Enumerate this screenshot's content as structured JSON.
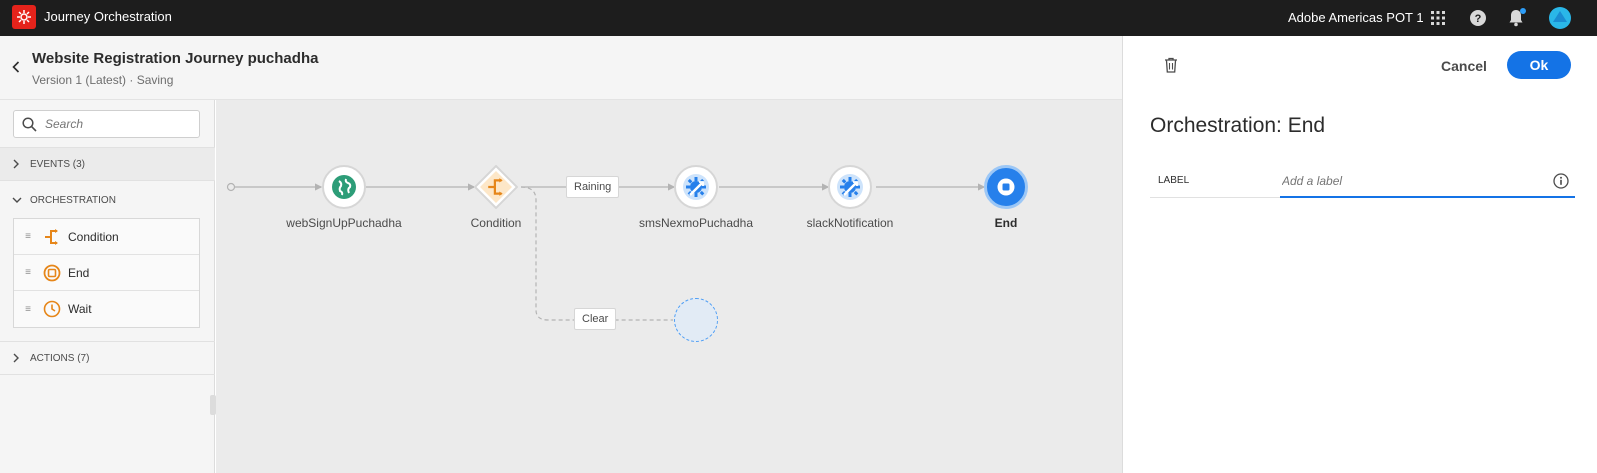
{
  "topbar": {
    "app_title": "Journey Orchestration",
    "org_name": "Adobe Americas POT 1",
    "icons": [
      "app-switcher-icon",
      "help-icon",
      "notifications-icon",
      "user-avatar-icon"
    ]
  },
  "header": {
    "title": "Website Registration Journey puchadha",
    "subtitle": "Version 1 (Latest) · Saving"
  },
  "palette": {
    "search_placeholder": "Search",
    "events_label": "EVENTS (3)",
    "orchestration_label": "ORCHESTRATION",
    "orchestration_items": [
      {
        "label": "Condition",
        "icon": "condition-icon"
      },
      {
        "label": "End",
        "icon": "end-icon"
      },
      {
        "label": "Wait",
        "icon": "wait-icon"
      }
    ],
    "actions_label": "ACTIONS (7)"
  },
  "canvas": {
    "nodes": [
      {
        "label": "webSignUpPuchadha",
        "type": "event",
        "icon": "globe-icon"
      },
      {
        "label": "Condition",
        "type": "condition",
        "icon": "condition-icon"
      },
      {
        "label": "smsNexmoPuchadha",
        "type": "action",
        "icon": "action-gear-icon"
      },
      {
        "label": "slackNotification",
        "type": "action",
        "icon": "action-gear-icon"
      },
      {
        "label": "End",
        "type": "end",
        "icon": "end-icon"
      }
    ],
    "edge_labels": {
      "raining": "Raining",
      "clear": "Clear"
    }
  },
  "panel": {
    "cancel_label": "Cancel",
    "ok_label": "Ok",
    "title": "Orchestration: End",
    "label_caption": "LABEL",
    "label_placeholder": "Add a label",
    "label_value": ""
  },
  "colors": {
    "topbar": "#1d1d1d",
    "brand": "#e4231b",
    "accent_blue": "#1473e6",
    "event_green": "#2d9d78",
    "condition_orange": "#e68619"
  }
}
